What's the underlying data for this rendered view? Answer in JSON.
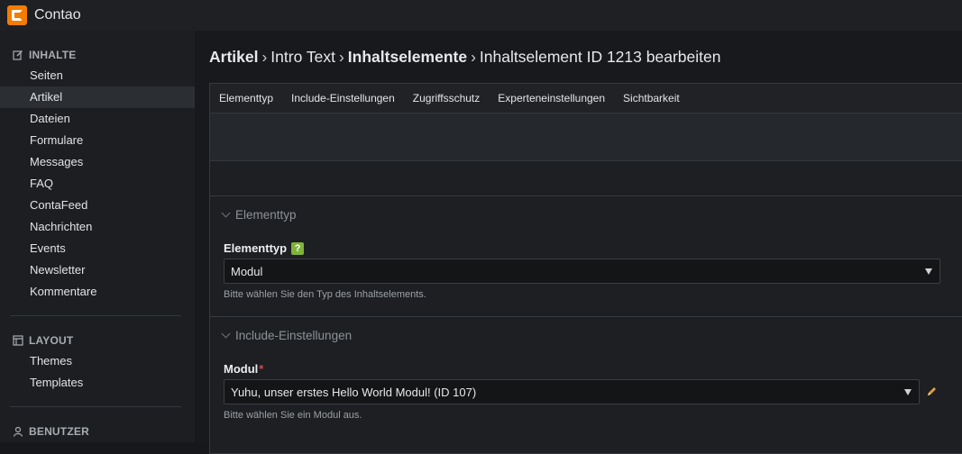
{
  "app": {
    "title": "Contao"
  },
  "sidebar": {
    "groups": [
      {
        "title": "INHALTE",
        "icon": "edit-icon",
        "items": [
          "Seiten",
          "Artikel",
          "Dateien",
          "Formulare",
          "Messages",
          "FAQ",
          "ContaFeed",
          "Nachrichten",
          "Events",
          "Newsletter",
          "Kommentare"
        ]
      },
      {
        "title": "LAYOUT",
        "icon": "layout-icon",
        "items": [
          "Themes",
          "Templates"
        ]
      },
      {
        "title": "BENUTZER",
        "icon": "user-icon",
        "items": []
      }
    ],
    "active_item": "Artikel"
  },
  "breadcrumb": {
    "part1": "Artikel",
    "part2": "Intro Text",
    "part3": "Inhaltselemente",
    "part4": "Inhaltselement ID 1213 bearbeiten",
    "separator": "›"
  },
  "tabs": [
    "Elementtyp",
    "Include-Einstellungen",
    "Zugriffsschutz",
    "Experteneinstellungen",
    "Sichtbarkeit"
  ],
  "sections": {
    "elementtyp": {
      "legend": "Elementtyp",
      "label": "Elementtyp",
      "help": "?",
      "value": "Modul",
      "hint": "Bitte wählen Sie den Typ des Inhaltselements."
    },
    "include": {
      "legend": "Include-Einstellungen",
      "label": "Modul",
      "required": "*",
      "value": "Yuhu, unser erstes Hello World Modul! (ID 107)",
      "hint": "Bitte wählen Sie ein Modul aus."
    }
  },
  "colors": {
    "accent": "#f47c00",
    "help": "#7fb439",
    "required": "#d04b4b",
    "pencil": "#e0a23a"
  }
}
